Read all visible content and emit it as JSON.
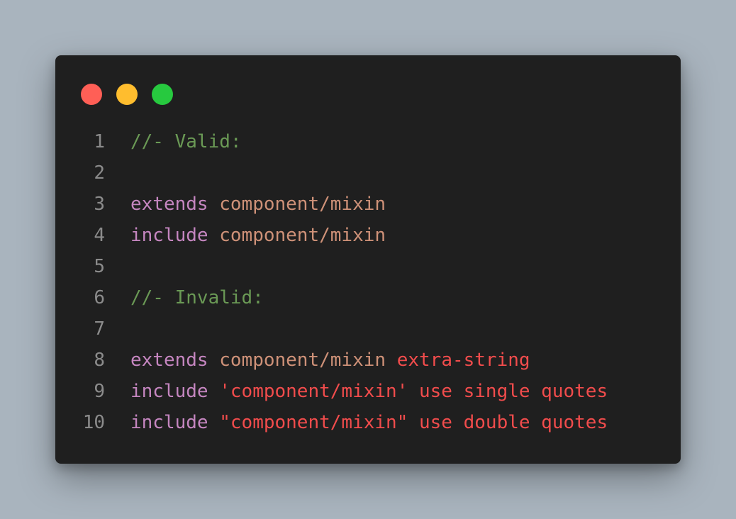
{
  "window": {
    "dots": [
      {
        "name": "close-dot",
        "color": "#ff5f56"
      },
      {
        "name": "minimize-dot",
        "color": "#ffbd2e"
      },
      {
        "name": "maximize-dot",
        "color": "#27c93f"
      }
    ]
  },
  "code": {
    "lines": [
      {
        "number": "1",
        "tokens": [
          {
            "text": "//- Valid:",
            "kind": "comment"
          }
        ]
      },
      {
        "number": "2",
        "tokens": []
      },
      {
        "number": "3",
        "tokens": [
          {
            "text": "extends",
            "kind": "keyword"
          },
          {
            "text": " ",
            "kind": "plain"
          },
          {
            "text": "component/mixin",
            "kind": "path"
          }
        ]
      },
      {
        "number": "4",
        "tokens": [
          {
            "text": "include",
            "kind": "keyword"
          },
          {
            "text": " ",
            "kind": "plain"
          },
          {
            "text": "component/mixin",
            "kind": "path"
          }
        ]
      },
      {
        "number": "5",
        "tokens": []
      },
      {
        "number": "6",
        "tokens": [
          {
            "text": "//- Invalid:",
            "kind": "comment"
          }
        ]
      },
      {
        "number": "7",
        "tokens": []
      },
      {
        "number": "8",
        "tokens": [
          {
            "text": "extends",
            "kind": "keyword"
          },
          {
            "text": " ",
            "kind": "plain"
          },
          {
            "text": "component/mixin",
            "kind": "path"
          },
          {
            "text": " ",
            "kind": "plain"
          },
          {
            "text": "extra-string",
            "kind": "error"
          }
        ]
      },
      {
        "number": "9",
        "tokens": [
          {
            "text": "include",
            "kind": "keyword"
          },
          {
            "text": " ",
            "kind": "plain"
          },
          {
            "text": "'component/mixin' use single quotes",
            "kind": "error"
          }
        ]
      },
      {
        "number": "10",
        "tokens": [
          {
            "text": "include",
            "kind": "keyword"
          },
          {
            "text": " ",
            "kind": "plain"
          },
          {
            "text": "\"component/mixin\" use double quotes",
            "kind": "error"
          }
        ]
      }
    ]
  },
  "colors": {
    "background": "#a9b4be",
    "editor": "#1f1f1f",
    "line_number": "#8b8b8b",
    "comment": "#6a9955",
    "keyword": "#c586c0",
    "path": "#ce9178",
    "error": "#f14c4c"
  }
}
